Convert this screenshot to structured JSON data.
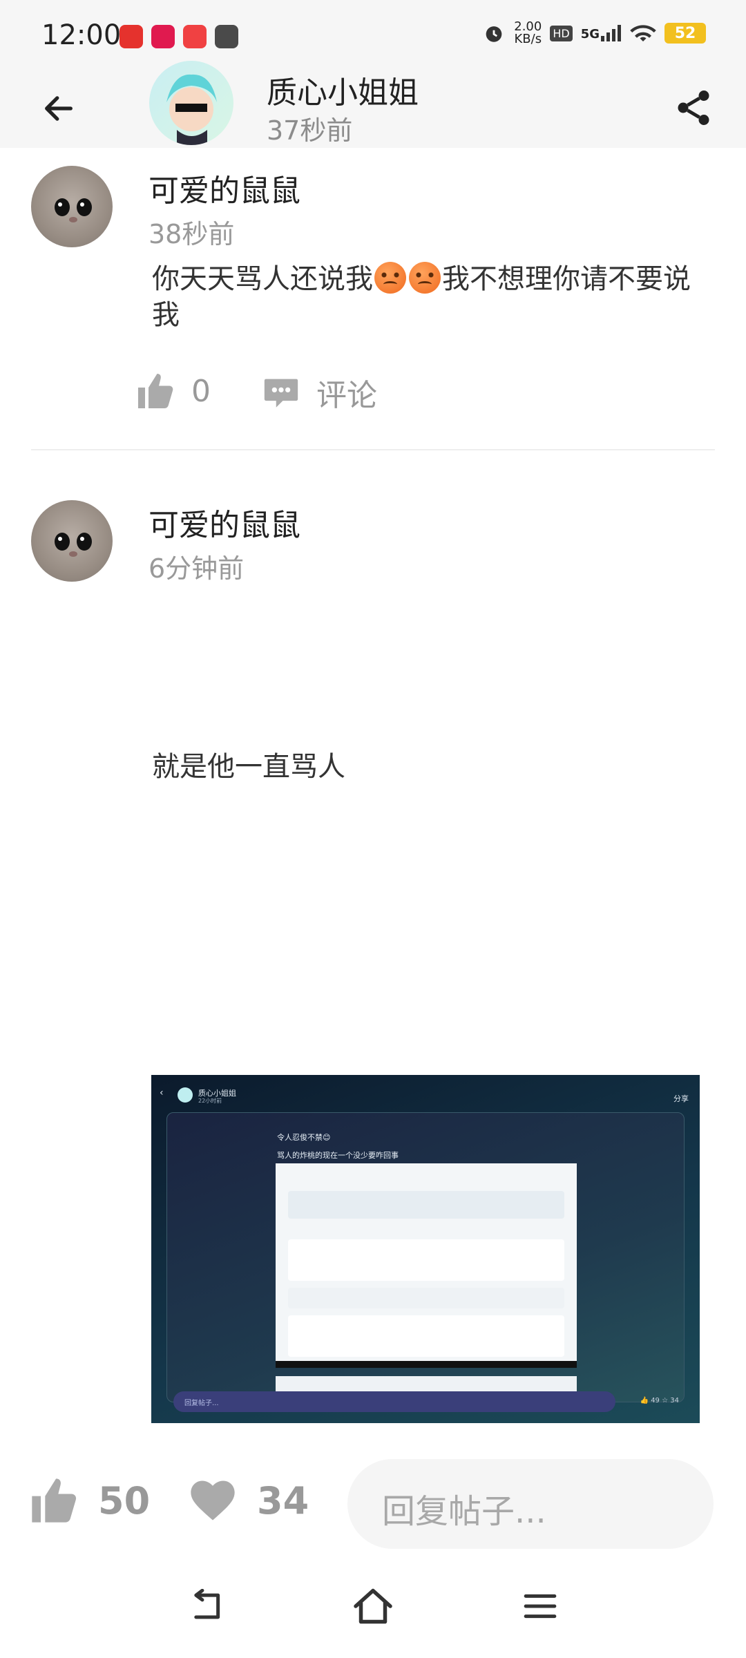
{
  "status_bar": {
    "time": "12:00",
    "net_speed_value": "2.00",
    "net_speed_unit": "KB/s",
    "hd_label": "HD",
    "signal_label": "5G",
    "battery": "52"
  },
  "header": {
    "poster_name": "质心小姐姐",
    "post_time": "37秒前"
  },
  "comments": [
    {
      "author": "可爱的鼠鼠",
      "time": "38秒前",
      "text_before": "你天天骂人还说我",
      "text_after": "我不想理你请不要说我",
      "likes": "0",
      "comment_label": "评论"
    },
    {
      "author": "可爱的鼠鼠",
      "time": "6分钟前",
      "text": "就是他一直骂人"
    }
  ],
  "embedded_screenshot": {
    "poster_name": "质心小姐姐",
    "post_time": "22小时前",
    "share_label": "分享",
    "line1": "令人忍俊不禁😊",
    "line2": "骂人的炸桃的现在一个没少要咋回事",
    "reply_placeholder": "回复帖子...",
    "likes": "49",
    "stars": "34"
  },
  "bottom_bar": {
    "likes": "50",
    "favorites": "34",
    "reply_placeholder": "回复帖子..."
  }
}
